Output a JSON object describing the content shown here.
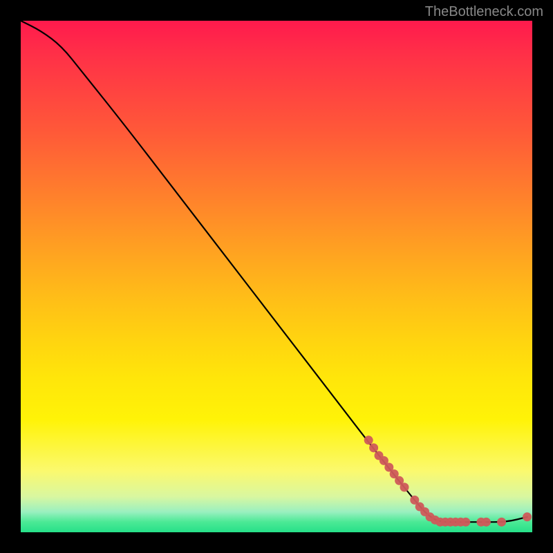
{
  "source_label": "TheBottleneck.com",
  "chart_data": {
    "type": "line",
    "title": "",
    "xlabel": "",
    "ylabel": "",
    "xlim": [
      0,
      100
    ],
    "ylim": [
      0,
      100
    ],
    "line": [
      {
        "x": 0,
        "y": 100
      },
      {
        "x": 4,
        "y": 98
      },
      {
        "x": 8,
        "y": 95
      },
      {
        "x": 12,
        "y": 90
      },
      {
        "x": 20,
        "y": 80
      },
      {
        "x": 30,
        "y": 67
      },
      {
        "x": 40,
        "y": 54
      },
      {
        "x": 50,
        "y": 41
      },
      {
        "x": 60,
        "y": 28
      },
      {
        "x": 70,
        "y": 15
      },
      {
        "x": 78,
        "y": 5
      },
      {
        "x": 80,
        "y": 3
      },
      {
        "x": 82,
        "y": 2
      },
      {
        "x": 86,
        "y": 2
      },
      {
        "x": 90,
        "y": 2
      },
      {
        "x": 95,
        "y": 2
      },
      {
        "x": 99,
        "y": 3
      }
    ],
    "highlighted_points": [
      {
        "x": 68,
        "y": 18
      },
      {
        "x": 69,
        "y": 16.5
      },
      {
        "x": 70,
        "y": 15
      },
      {
        "x": 71,
        "y": 14
      },
      {
        "x": 72,
        "y": 12.7
      },
      {
        "x": 73,
        "y": 11.4
      },
      {
        "x": 74,
        "y": 10.1
      },
      {
        "x": 75,
        "y": 8.8
      },
      {
        "x": 77,
        "y": 6.3
      },
      {
        "x": 78,
        "y": 5
      },
      {
        "x": 79,
        "y": 4
      },
      {
        "x": 80,
        "y": 3
      },
      {
        "x": 81,
        "y": 2.4
      },
      {
        "x": 82,
        "y": 2
      },
      {
        "x": 83,
        "y": 2
      },
      {
        "x": 84,
        "y": 2
      },
      {
        "x": 85,
        "y": 2
      },
      {
        "x": 86,
        "y": 2
      },
      {
        "x": 87,
        "y": 2
      },
      {
        "x": 90,
        "y": 2
      },
      {
        "x": 91,
        "y": 2
      },
      {
        "x": 94,
        "y": 2
      },
      {
        "x": 99,
        "y": 3
      }
    ],
    "colors": {
      "line": "#000000",
      "dots": "#cf5a5a",
      "gradient_top": "#ff1a4d",
      "gradient_mid": "#ffe60a",
      "gradient_bottom": "#26e089"
    }
  }
}
